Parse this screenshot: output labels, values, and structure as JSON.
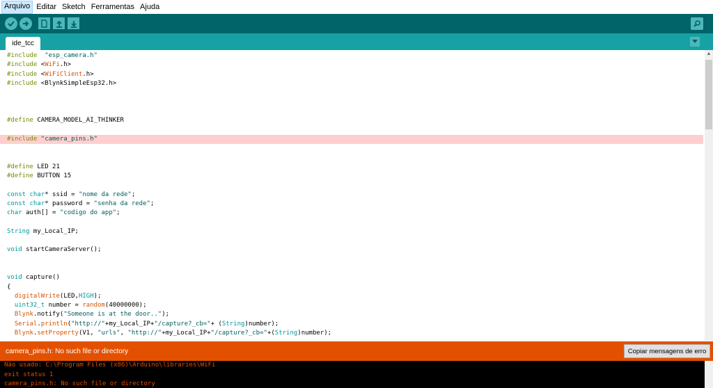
{
  "menu": [
    "Arquivo",
    "Editar",
    "Sketch",
    "Ferramentas",
    "Ajuda"
  ],
  "toolbar": {
    "verify": "check-icon",
    "upload": "arrow-right-icon",
    "new": "new-file-icon",
    "open": "arrow-up-icon",
    "save": "arrow-down-icon",
    "serial_monitor": "magnifier-icon"
  },
  "tab": {
    "label": "ide_tcc"
  },
  "code": [
    {
      "y": 0,
      "parts": [
        [
          "kw",
          "#include"
        ],
        [
          "",
          "  "
        ],
        [
          "str",
          "\"esp_camera.h\""
        ]
      ]
    },
    {
      "y": 1,
      "parts": [
        [
          "kw",
          "#include"
        ],
        [
          "",
          " <"
        ],
        [
          "fn",
          "WiFi"
        ],
        [
          "",
          ".h>"
        ]
      ]
    },
    {
      "y": 2,
      "parts": [
        [
          "kw",
          "#include"
        ],
        [
          "",
          " <"
        ],
        [
          "fn",
          "WiFiClient"
        ],
        [
          "",
          ".h>"
        ]
      ]
    },
    {
      "y": 3,
      "parts": [
        [
          "kw",
          "#include"
        ],
        [
          "",
          " <BlynkSimpleEsp32.h>"
        ]
      ]
    },
    {
      "y": 7,
      "parts": [
        [
          "kw",
          "#define"
        ],
        [
          "",
          " CAMERA_MODEL_AI_THINKER"
        ]
      ]
    },
    {
      "y": 9,
      "error": true,
      "parts": [
        [
          "kw",
          "#include"
        ],
        [
          "",
          " "
        ],
        [
          "str",
          "\"camera_pins.h\""
        ]
      ]
    },
    {
      "y": 12,
      "parts": [
        [
          "kw",
          "#define"
        ],
        [
          "",
          " LED 21"
        ]
      ]
    },
    {
      "y": 13,
      "parts": [
        [
          "kw",
          "#define"
        ],
        [
          "",
          " BUTTON 15"
        ]
      ]
    },
    {
      "y": 15,
      "parts": [
        [
          "ty",
          "const"
        ],
        [
          "",
          " "
        ],
        [
          "ty",
          "char"
        ],
        [
          "",
          "* ssid = "
        ],
        [
          "str",
          "\"nome da rede\""
        ],
        [
          "",
          ";"
        ]
      ]
    },
    {
      "y": 16,
      "parts": [
        [
          "ty",
          "const"
        ],
        [
          "",
          " "
        ],
        [
          "ty",
          "char"
        ],
        [
          "",
          "* password = "
        ],
        [
          "str",
          "\"senha da rede\""
        ],
        [
          "",
          ";"
        ]
      ]
    },
    {
      "y": 17,
      "parts": [
        [
          "ty",
          "char"
        ],
        [
          "",
          " auth[] = "
        ],
        [
          "str",
          "\"codigo do app\""
        ],
        [
          "",
          ";"
        ]
      ]
    },
    {
      "y": 19,
      "parts": [
        [
          "ty",
          "String"
        ],
        [
          "",
          " my_Local_IP;"
        ]
      ]
    },
    {
      "y": 21,
      "parts": [
        [
          "ty",
          "void"
        ],
        [
          "",
          " startCameraServer();"
        ]
      ]
    },
    {
      "y": 24,
      "parts": [
        [
          "ty",
          "void"
        ],
        [
          "",
          " capture()"
        ]
      ]
    },
    {
      "y": 25,
      "parts": [
        [
          "",
          "{"
        ]
      ]
    },
    {
      "y": 26,
      "parts": [
        [
          "",
          "  "
        ],
        [
          "fn",
          "digitalWrite"
        ],
        [
          "",
          "(LED,"
        ],
        [
          "ty",
          "HIGH"
        ],
        [
          "",
          ");"
        ]
      ]
    },
    {
      "y": 27,
      "parts": [
        [
          "",
          "  "
        ],
        [
          "ty",
          "uint32_t"
        ],
        [
          "",
          " number = "
        ],
        [
          "fn",
          "random"
        ],
        [
          "",
          "(40000000);"
        ]
      ]
    },
    {
      "y": 28,
      "parts": [
        [
          "",
          "  "
        ],
        [
          "fn",
          "Blynk"
        ],
        [
          "",
          ".notify("
        ],
        [
          "str",
          "\"Someone is at the door..\""
        ],
        [
          "",
          ");"
        ]
      ]
    },
    {
      "y": 29,
      "parts": [
        [
          "",
          "  "
        ],
        [
          "fn",
          "Serial"
        ],
        [
          "",
          "."
        ],
        [
          "fn",
          "println"
        ],
        [
          "",
          "("
        ],
        [
          "str",
          "\"http://\""
        ],
        [
          "",
          "+my_Local_IP+"
        ],
        [
          "str",
          "\"/capture?_cb=\""
        ],
        [
          "",
          "+ ("
        ],
        [
          "ty",
          "String"
        ],
        [
          "",
          ")number);"
        ]
      ]
    },
    {
      "y": 30,
      "parts": [
        [
          "",
          "  "
        ],
        [
          "fn",
          "Blynk"
        ],
        [
          "",
          "."
        ],
        [
          "fn",
          "setProperty"
        ],
        [
          "",
          "(V1, "
        ],
        [
          "str",
          "\"urls\""
        ],
        [
          "",
          ", "
        ],
        [
          "str",
          "\"http://\""
        ],
        [
          "",
          "+my_Local_IP+"
        ],
        [
          "str",
          "\"/capture?_cb=\""
        ],
        [
          "",
          "+("
        ],
        [
          "ty",
          "String"
        ],
        [
          "",
          ")number);"
        ]
      ]
    }
  ],
  "status": {
    "message": "camera_pins.h: No such file or directory",
    "copy_button": "Copiar mensagens de erro"
  },
  "console": [
    "Não usado: C:\\Program Files (x86)\\Arduino\\libraries\\WiFi",
    "exit status 1",
    "camera_pins.h: No such file or directory"
  ]
}
